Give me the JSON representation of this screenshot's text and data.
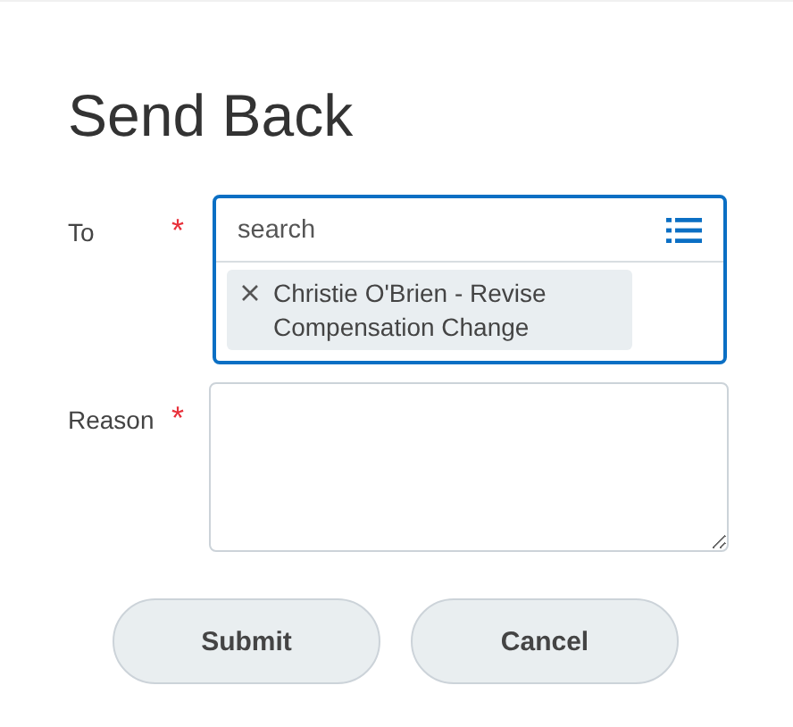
{
  "title": "Send Back",
  "fields": [
    {
      "kind": "prompt",
      "label": "To",
      "required_mark": "*",
      "placeholder": "search",
      "focused": true,
      "selections": [
        "Christie O'Brien - Revise Compensation Change"
      ]
    },
    {
      "kind": "textarea",
      "label": "Reason",
      "required_mark": "*",
      "focused": false
    }
  ],
  "buttons": [
    "Submit",
    "Cancel"
  ]
}
